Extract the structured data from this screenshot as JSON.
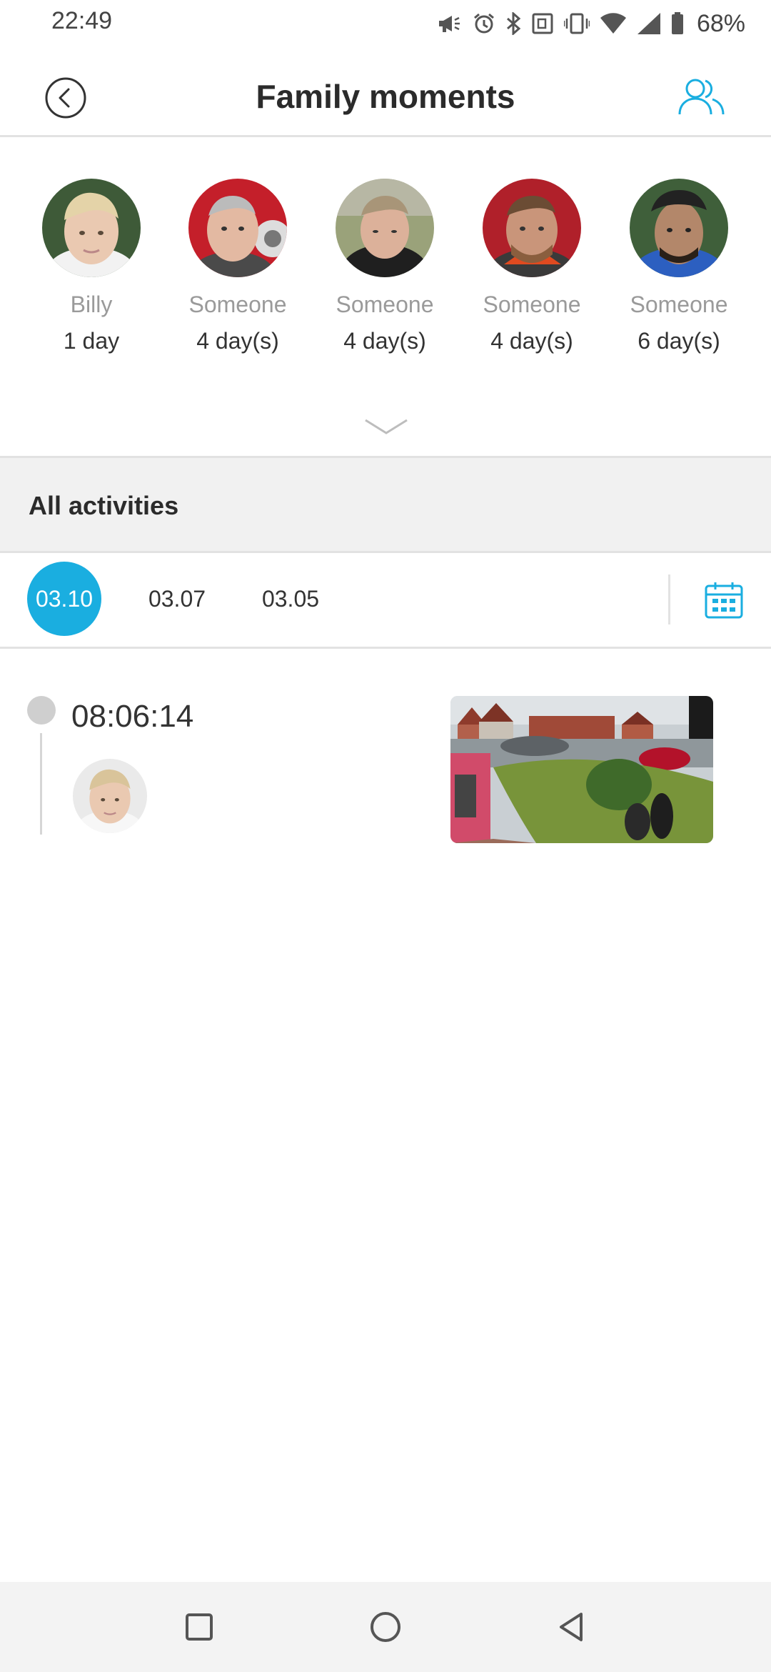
{
  "status_bar": {
    "time": "22:49",
    "battery": "68%",
    "icons": [
      "megaphone-icon",
      "alarm-icon",
      "bluetooth-icon",
      "nfc-icon",
      "vibrate-icon",
      "wifi-icon",
      "signal-icon",
      "battery-icon"
    ]
  },
  "header": {
    "title": "Family moments",
    "back_icon": "back-circle-icon",
    "people_icon": "people-icon",
    "accent_color": "#1aaee0"
  },
  "faces": [
    {
      "name": "Billy",
      "days": "1 day"
    },
    {
      "name": "Someone",
      "days": "4 day(s)"
    },
    {
      "name": "Someone",
      "days": "4 day(s)"
    },
    {
      "name": "Someone",
      "days": "4 day(s)"
    },
    {
      "name": "Someone",
      "days": "6 day(s)"
    }
  ],
  "activities": {
    "title": "All activities",
    "dates": [
      "03.10",
      "03.07",
      "03.05"
    ],
    "selected_date": "03.10",
    "calendar_icon": "calendar-icon"
  },
  "timeline": {
    "entries": [
      {
        "time": "08:06:14"
      }
    ]
  },
  "nav_bar": {
    "buttons": [
      "recents-icon",
      "home-icon",
      "back-triangle-icon"
    ]
  }
}
